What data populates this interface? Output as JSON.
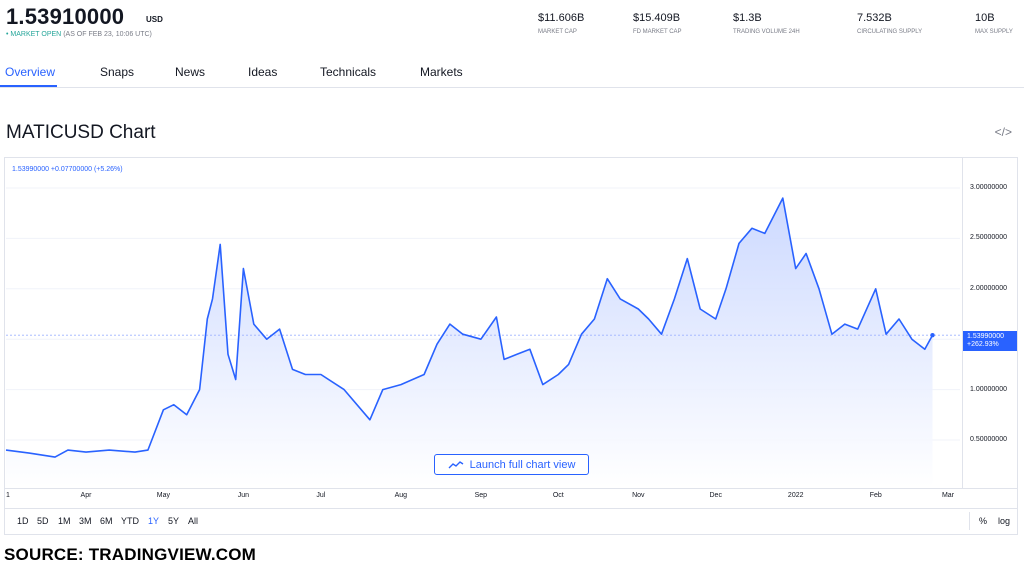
{
  "header": {
    "price": "1.53910000",
    "unit": "USD",
    "status_dot": "•",
    "status": "MARKET OPEN",
    "status_time": "(AS OF FEB 23, 10:06 UTC)"
  },
  "stats": [
    {
      "value": "$11.606B",
      "label": "MARKET CAP"
    },
    {
      "value": "$15.409B",
      "label": "FD MARKET CAP"
    },
    {
      "value": "$1.3B",
      "label": "TRADING VOLUME 24H"
    },
    {
      "value": "7.532B",
      "label": "CIRCULATING SUPPLY"
    },
    {
      "value": "10B",
      "label": "MAX SUPPLY"
    }
  ],
  "tabs": [
    "Overview",
    "Snaps",
    "News",
    "Ideas",
    "Technicals",
    "Markets"
  ],
  "chart_title": "MATICUSD Chart",
  "embed_icon": "code-embed-icon",
  "legend": "1.53990000 +0.07700000 (+5.26%)",
  "price_tag": {
    "price": "1.53990000",
    "change": "+262.93%"
  },
  "launch_button": "Launch full chart view",
  "ranges": [
    "1D",
    "5D",
    "1M",
    "3M",
    "6M",
    "YTD",
    "1Y",
    "5Y",
    "All"
  ],
  "active_range": "1Y",
  "scale_buttons": [
    "%",
    "log"
  ],
  "source": "SOURCE: TRADINGVIEW.COM",
  "colors": {
    "accent": "#2962ff",
    "line": "#2962ff",
    "fill": "#dfe7ff",
    "market_open": "#26a69a"
  },
  "chart_data": {
    "type": "area",
    "x_tick_labels": [
      "1",
      "Apr",
      "May",
      "Jun",
      "Jul",
      "Aug",
      "Sep",
      "Oct",
      "Nov",
      "Dec",
      "2022",
      "Feb",
      "Mar"
    ],
    "y_tick_labels": [
      "3.00000000",
      "2.50000000",
      "2.00000000",
      "1.50000000",
      "1.00000000",
      "0.50000000"
    ],
    "y_ticks": [
      3.0,
      2.5,
      2.0,
      1.5,
      1.0,
      0.5
    ],
    "ylim": [
      0.0,
      3.3
    ],
    "x": [
      "2021-03-01",
      "2021-03-10",
      "2021-03-20",
      "2021-03-25",
      "2021-04-01",
      "2021-04-10",
      "2021-04-20",
      "2021-04-25",
      "2021-05-01",
      "2021-05-05",
      "2021-05-10",
      "2021-05-15",
      "2021-05-18",
      "2021-05-20",
      "2021-05-23",
      "2021-05-26",
      "2021-05-29",
      "2021-06-01",
      "2021-06-05",
      "2021-06-10",
      "2021-06-15",
      "2021-06-20",
      "2021-06-25",
      "2021-07-01",
      "2021-07-10",
      "2021-07-20",
      "2021-07-25",
      "2021-08-01",
      "2021-08-10",
      "2021-08-15",
      "2021-08-20",
      "2021-08-25",
      "2021-09-01",
      "2021-09-07",
      "2021-09-10",
      "2021-09-15",
      "2021-09-20",
      "2021-09-25",
      "2021-10-01",
      "2021-10-05",
      "2021-10-10",
      "2021-10-15",
      "2021-10-20",
      "2021-10-25",
      "2021-11-01",
      "2021-11-05",
      "2021-11-10",
      "2021-11-15",
      "2021-11-20",
      "2021-11-25",
      "2021-12-01",
      "2021-12-05",
      "2021-12-10",
      "2021-12-15",
      "2021-12-20",
      "2021-12-27",
      "2022-01-01",
      "2022-01-05",
      "2022-01-10",
      "2022-01-15",
      "2022-01-20",
      "2022-01-25",
      "2022-02-01",
      "2022-02-05",
      "2022-02-10",
      "2022-02-15",
      "2022-02-20",
      "2022-02-23"
    ],
    "values": [
      0.4,
      0.37,
      0.33,
      0.4,
      0.38,
      0.4,
      0.38,
      0.4,
      0.8,
      0.85,
      0.75,
      1.0,
      1.7,
      1.9,
      2.44,
      1.35,
      1.1,
      2.2,
      1.65,
      1.5,
      1.6,
      1.2,
      1.15,
      1.15,
      1.0,
      0.7,
      1.0,
      1.05,
      1.15,
      1.45,
      1.65,
      1.55,
      1.5,
      1.72,
      1.3,
      1.35,
      1.4,
      1.05,
      1.15,
      1.25,
      1.55,
      1.7,
      2.1,
      1.9,
      1.8,
      1.7,
      1.55,
      1.9,
      2.3,
      1.8,
      1.7,
      2.0,
      2.45,
      2.6,
      2.55,
      2.9,
      2.2,
      2.35,
      2.0,
      1.55,
      1.65,
      1.6,
      2.0,
      1.55,
      1.7,
      1.5,
      1.4,
      1.54
    ]
  }
}
